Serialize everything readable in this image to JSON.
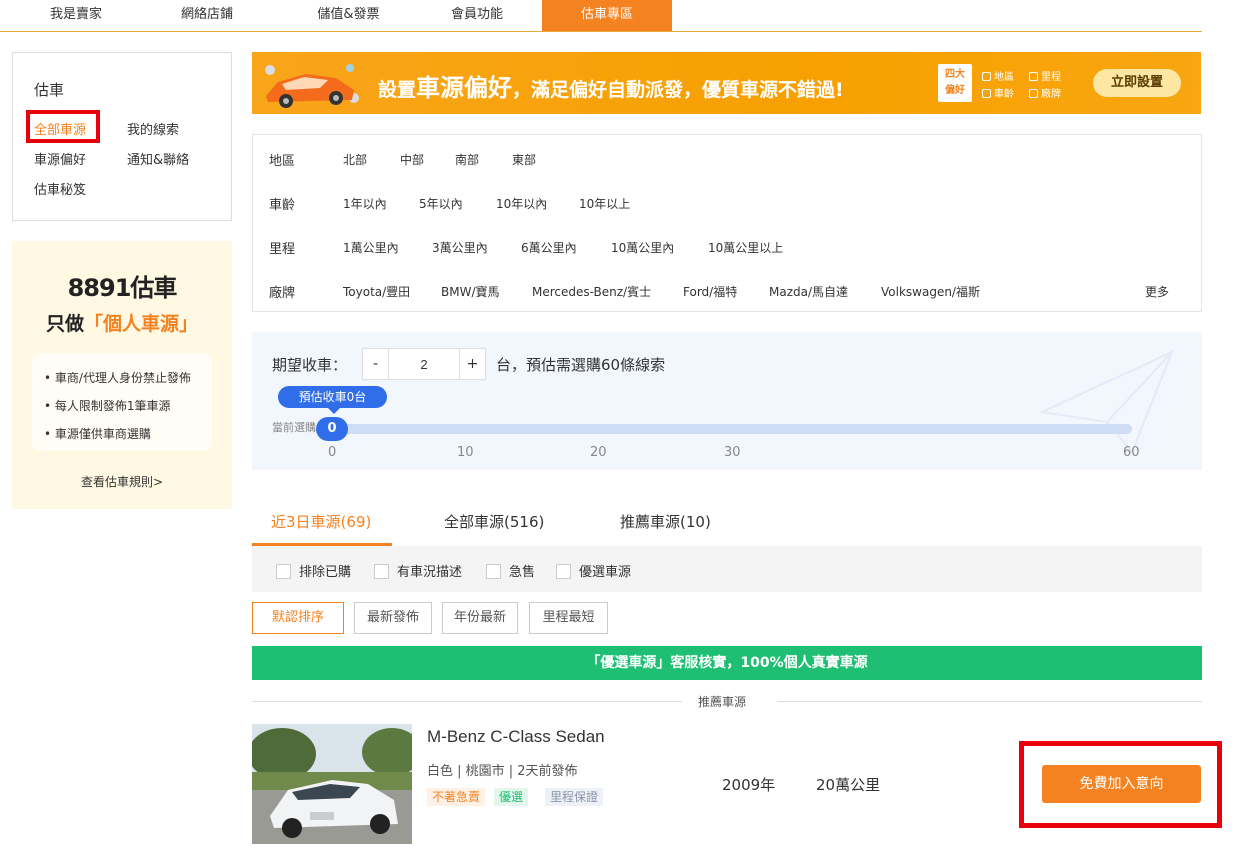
{
  "topnav": {
    "tabs": [
      {
        "label": "我是賣家"
      },
      {
        "label": "網絡店鋪"
      },
      {
        "label": "儲值&發票"
      },
      {
        "label": "會員功能"
      },
      {
        "label": "估車專區"
      }
    ],
    "active_index": 4
  },
  "sidebar": {
    "title": "估車",
    "items": [
      {
        "label": "全部車源",
        "active": true
      },
      {
        "label": "我的線索"
      },
      {
        "label": "車源偏好"
      },
      {
        "label": "通知&聯絡"
      },
      {
        "label": "估車秘笈"
      }
    ]
  },
  "promo": {
    "brand": "8891估車",
    "slogan_prefix": "只做",
    "slogan_highlight": "「個人車源」",
    "rules": [
      "車商/代理人身份禁止發佈",
      "每人限制發佈1筆車源",
      "車源僅供車商選購"
    ],
    "more_link": "查看估車規則>"
  },
  "banner": {
    "headline_part1": "設置",
    "headline_big": "車源偏好",
    "headline_part2": "，滿足偏好自動派發，優質車源不錯過!",
    "badge_line1": "四大",
    "badge_line2": "偏好",
    "chips": [
      "地區",
      "里程",
      "車齡",
      "廠牌"
    ],
    "cta": "立即設置"
  },
  "filters": [
    {
      "label": "地區",
      "options": [
        "北部",
        "中部",
        "南部",
        "東部"
      ]
    },
    {
      "label": "車齡",
      "options": [
        "1年以內",
        "5年以內",
        "10年以內",
        "10年以上"
      ]
    },
    {
      "label": "里程",
      "options": [
        "1萬公里內",
        "3萬公里內",
        "6萬公里內",
        "10萬公里內",
        "10萬公里以上"
      ]
    },
    {
      "label": "廠牌",
      "options": [
        "Toyota/豐田",
        "BMW/寶馬",
        "Mercedes-Benz/賓士",
        "Ford/福特",
        "Mazda/馬自達",
        "Volkswagen/福斯"
      ],
      "more": "更多"
    }
  ],
  "quantity": {
    "label": "期望收車：",
    "minus": "-",
    "plus": "+",
    "value": "2",
    "note": "台，預估需選購60條線索",
    "bubble": "預估收車0台",
    "current_label": "當前選購",
    "slider_value": "0",
    "ticks": [
      "0",
      "10",
      "20",
      "30",
      "60"
    ]
  },
  "tabs": [
    {
      "label": "近3日車源(69)",
      "active": true
    },
    {
      "label": "全部車源(516)"
    },
    {
      "label": "推薦車源(10)"
    }
  ],
  "checks": [
    "排除已購",
    "有車況描述",
    "急售",
    "優選車源"
  ],
  "sorts": [
    {
      "label": "默認排序",
      "active": true
    },
    {
      "label": "最新發佈"
    },
    {
      "label": "年份最新"
    },
    {
      "label": "里程最短"
    }
  ],
  "notice": "「優選車源」客服核實，100%個人真實車源",
  "divider_label": "推薦車源",
  "listing": {
    "name": "M-Benz C-Class Sedan",
    "meta": "白色 | 桃園市 | 2天前發佈",
    "tags": [
      "不著急賣",
      "優選",
      "里程保證"
    ],
    "year": "2009年",
    "mileage": "20萬公里",
    "cta": "免費加入意向"
  },
  "colors": {
    "accent": "#f58220",
    "blue": "#2f6ee8",
    "green": "#1fbf73",
    "highlight_red": "#e8000b"
  }
}
